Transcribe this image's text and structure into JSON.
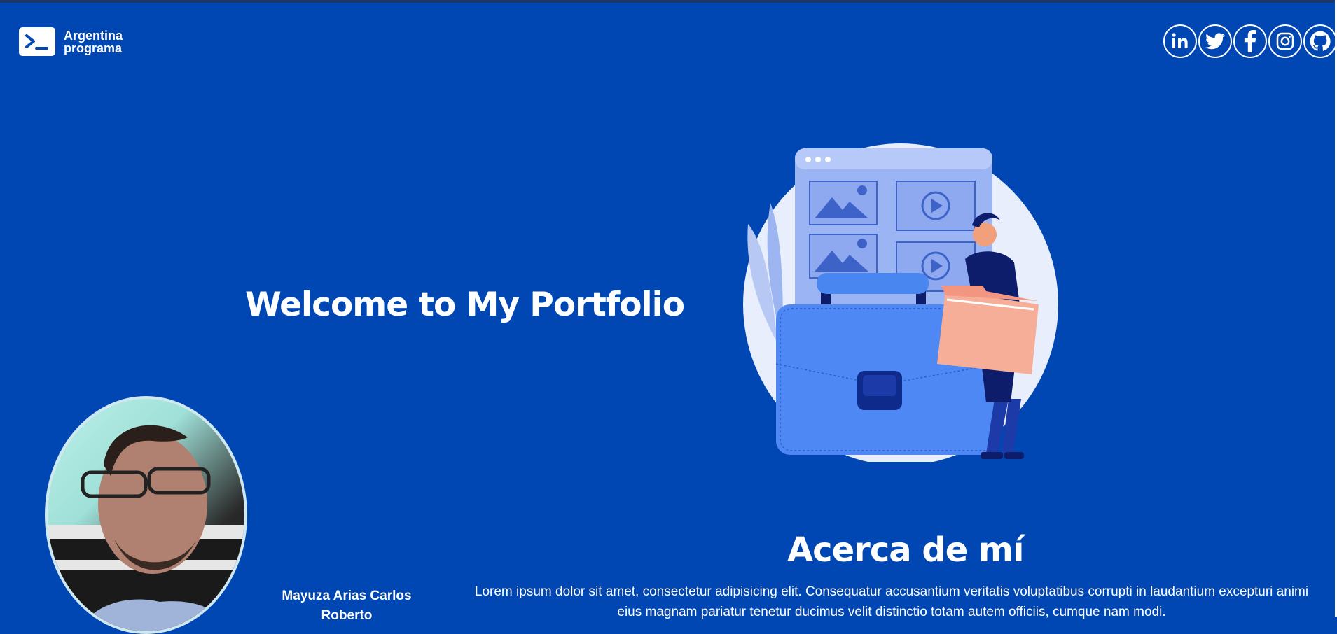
{
  "header": {
    "logo_line1": "Argentina",
    "logo_line2": "programa"
  },
  "social": [
    {
      "name": "linkedin-icon",
      "label": "LinkedIn"
    },
    {
      "name": "twitter-icon",
      "label": "Twitter"
    },
    {
      "name": "facebook-icon",
      "label": "Facebook"
    },
    {
      "name": "instagram-icon",
      "label": "Instagram"
    },
    {
      "name": "github-icon",
      "label": "GitHub"
    }
  ],
  "hero": {
    "title": "Welcome to My Portfolio"
  },
  "about": {
    "title": "Acerca de mí",
    "name": "Mayuza Arias Carlos Roberto",
    "text": "Lorem ipsum dolor sit amet, consectetur adipisicing elit. Consequatur accusantium veritatis voluptatibus corrupti in laudantium excepturi animi eius magnam pariatur tenetur ducimus velit distinctio totam autem officiis, cumque nam modi."
  },
  "colors": {
    "background": "#0047b3",
    "text": "#ffffff"
  }
}
